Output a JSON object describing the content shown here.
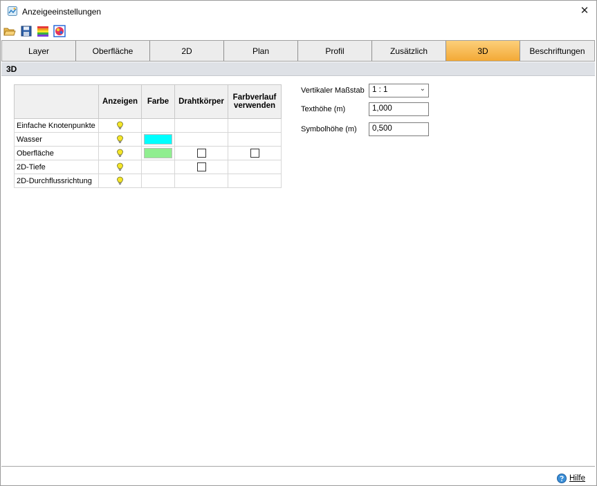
{
  "window": {
    "title": "Anzeigeeinstellungen"
  },
  "toolbar": {
    "icons": [
      "open-folder-icon",
      "save-icon",
      "color-bars-icon",
      "color-palette-icon"
    ]
  },
  "tabs": [
    {
      "label": "Layer",
      "active": false
    },
    {
      "label": "Oberfläche",
      "active": false
    },
    {
      "label": "2D",
      "active": false
    },
    {
      "label": "Plan",
      "active": false
    },
    {
      "label": "Profil",
      "active": false
    },
    {
      "label": "Zusätzlich",
      "active": false
    },
    {
      "label": "3D",
      "active": true
    },
    {
      "label": "Beschriftungen",
      "active": false
    }
  ],
  "section": {
    "title": "3D"
  },
  "grid": {
    "headers": {
      "name": "",
      "anzeigen": "Anzeigen",
      "farbe": "Farbe",
      "draht": "Drahtkörper",
      "farbverlauf": "Farbverlauf verwenden"
    },
    "rows": [
      {
        "name": "Einfache Knotenpunkte",
        "visible": true,
        "color": null,
        "wire": null,
        "gradient": null
      },
      {
        "name": "Wasser",
        "visible": true,
        "color": "#00ffff",
        "wire": null,
        "gradient": null
      },
      {
        "name": "Oberfläche",
        "visible": true,
        "color": "#90ee90",
        "wire": false,
        "gradient": false
      },
      {
        "name": "2D-Tiefe",
        "visible": true,
        "color": null,
        "wire": false,
        "gradient": null
      },
      {
        "name": "2D-Durchflussrichtung",
        "visible": true,
        "color": null,
        "wire": null,
        "gradient": null
      }
    ]
  },
  "properties": {
    "vertical_scale": {
      "label": "Vertikaler Maßstab",
      "value": "1 : 1"
    },
    "text_height": {
      "label": "Texthöhe (m)",
      "value": "1,000"
    },
    "symbol_height": {
      "label": "Symbolhöhe (m)",
      "value": "0,500"
    }
  },
  "footer": {
    "help_label": "Hilfe"
  },
  "colors": {
    "active_tab_top": "#fccf7a",
    "active_tab_bottom": "#f3a936",
    "section_bg": "#dee1e6",
    "bulb": "#f5e629"
  }
}
